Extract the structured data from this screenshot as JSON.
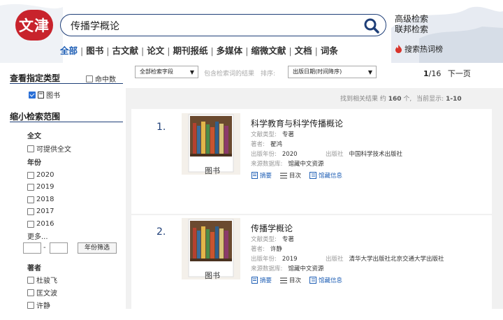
{
  "logo": {
    "text": "文津"
  },
  "search": {
    "query": "传播学概论"
  },
  "header": {
    "advanced_search": "高级检索",
    "federated_search": "联邦检索",
    "hot_words": "搜索热词榜"
  },
  "nav": {
    "items": [
      "全部",
      "图书",
      "古文献",
      "论文",
      "期刊报纸",
      "多媒体",
      "缩微文献",
      "文档",
      "词条"
    ]
  },
  "sidebar": {
    "type_title": "查看指定类型",
    "hit_count_label": "命中数",
    "type_book": "图书",
    "narrow_title": "缩小检索范围",
    "fulltext_title": "全文",
    "fulltext_option": "可提供全文",
    "year_title": "年份",
    "years": [
      "2020",
      "2019",
      "2018",
      "2017",
      "2016"
    ],
    "more": "更多...",
    "year_separator": "-",
    "year_filter_button": "年份筛选",
    "author_title": "著者",
    "authors": [
      "杜骏飞",
      "匡文波",
      "许静"
    ]
  },
  "toolbar": {
    "field_select": "全部检索字段",
    "include_results": "包含检索词的结果",
    "sort_label": "排序:",
    "sort_select": "出版日期(时间降序)",
    "page_current": "1",
    "page_total": "/16",
    "next_page": "下一页"
  },
  "summary": {
    "prefix": "找到相关结果 约",
    "count": "160",
    "suffix": "个,",
    "display_label": "当前显示:",
    "range": "1-10"
  },
  "results": [
    {
      "number": "1.",
      "cover_label": "图书",
      "title": "科学教育与科学传播概论",
      "type_label": "文献类型:",
      "type_value": "专著",
      "author_label": "著者:",
      "author_value": "翟鸿",
      "year_label": "出版年份:",
      "year_value": "2020",
      "publisher_label": "出版社",
      "publisher_value": "中国科学技术出版社",
      "source_label": "来源数据库:",
      "source_value": "馆藏中文资源",
      "actions": [
        "摘要",
        "目次",
        "馆藏信息"
      ]
    },
    {
      "number": "2.",
      "cover_label": "图书",
      "title": "传播学概论",
      "type_label": "文献类型:",
      "type_value": "专著",
      "author_label": "著者:",
      "author_value": "许静",
      "year_label": "出版年份:",
      "year_value": "2019",
      "publisher_label": "出版社",
      "publisher_value": "清华大学出版社北京交通大学出版社",
      "source_label": "来源数据库:",
      "source_value": "馆藏中文资源",
      "actions": [
        "摘要",
        "目次",
        "馆藏信息"
      ]
    }
  ],
  "colors": {
    "logo_red": "#c8232c",
    "link_blue": "#1f5fb5",
    "navy": "#1f3f78",
    "panel_gray": "#f1f1f1"
  }
}
